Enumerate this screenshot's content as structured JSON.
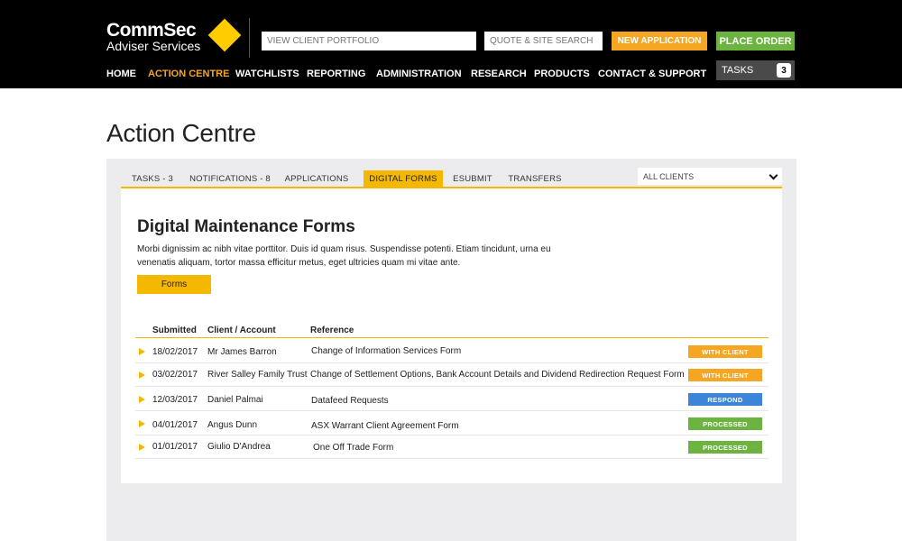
{
  "brand": {
    "line1": "CommSec",
    "line2": "Adviser Services",
    "accent": "#ffcc00"
  },
  "header": {
    "portfolio_placeholder": "VIEW CLIENT PORTFOLIO",
    "quote_placeholder": "QUOTE & SITE SEARCH",
    "new_application": "NEW APPLICATION",
    "place_order": "PLACE ORDER",
    "tasks_label": "TASKS",
    "tasks_count": "3"
  },
  "nav": [
    {
      "label": "HOME",
      "active": false
    },
    {
      "label": "ACTION CENTRE",
      "active": true
    },
    {
      "label": "WATCHLISTS",
      "active": false
    },
    {
      "label": "REPORTING",
      "active": false
    },
    {
      "label": "ADMINISTRATION",
      "active": false
    },
    {
      "label": "RESEARCH",
      "active": false
    },
    {
      "label": "PRODUCTS",
      "active": false
    },
    {
      "label": "CONTACT & SUPPORT",
      "active": false
    }
  ],
  "page": {
    "title": "Action Centre"
  },
  "tabs": [
    {
      "label": "TASKS - 3",
      "active": false
    },
    {
      "label": "NOTIFICATIONS - 8",
      "active": false
    },
    {
      "label": "APPLICATIONS",
      "active": false
    },
    {
      "label": "DIGITAL FORMS",
      "active": true
    },
    {
      "label": "ESUBMIT",
      "active": false
    },
    {
      "label": "TRANSFERS",
      "active": false
    }
  ],
  "client_filter": {
    "selected": "ALL CLIENTS",
    "icon": "chevron-down-icon"
  },
  "section": {
    "title": "Digital Maintenance Forms",
    "description": "Morbi dignissim ac nibh vitae porttitor. Duis id quam risus. Suspendisse potenti. Etiam tincidunt, urna eu venenatis aliquam, tortor massa efficitur metus, eget ultricies quam mi vitae ante.",
    "forms_button": "Forms"
  },
  "table": {
    "columns": [
      "Submitted",
      "Client / Account",
      "Reference"
    ],
    "rows": [
      {
        "submitted": "18/02/2017",
        "client": "Mr James Barron",
        "reference": "Change of Information Services Form",
        "status": "WITH CLIENT",
        "status_color": "#f5a623"
      },
      {
        "submitted": "03/02/2017",
        "client": "River Salley Family Trust",
        "reference": "Change of Settlement Options, Bank Account Details and Dividend Redirection Request Form",
        "status": "WITH CLIENT",
        "status_color": "#f5a623"
      },
      {
        "submitted": "12/03/2017",
        "client": "Daniel Palmai",
        "reference": "Datafeed Requests",
        "status": "RESPOND",
        "status_color": "#3d85d8"
      },
      {
        "submitted": "04/01/2017",
        "client": "Angus Dunn",
        "reference": "ASX Warrant Client Agreement Form",
        "status": "PROCESSED",
        "status_color": "#6cb33f"
      },
      {
        "submitted": "01/01/2017",
        "client": "Giulio D'Andrea",
        "reference": "One Off Trade Form",
        "status": "PROCESSED",
        "status_color": "#6cb33f"
      }
    ]
  }
}
